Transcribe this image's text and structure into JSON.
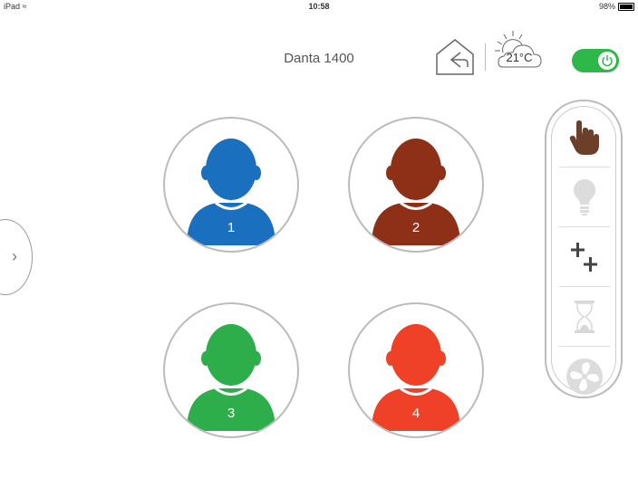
{
  "status_bar": {
    "device": "iPad",
    "time": "10:58",
    "battery": "98%"
  },
  "header": {
    "title": "Danta 1400",
    "temperature": "21°C"
  },
  "colors": {
    "accent": "#2eb84a",
    "user1": "#1a6fbf",
    "user2": "#8e2f18",
    "user3": "#2eae4a",
    "user4": "#ee4128"
  },
  "users": [
    {
      "label": "1",
      "color": "#1a6fbf"
    },
    {
      "label": "2",
      "color": "#8e2f18"
    },
    {
      "label": "3",
      "color": "#2eae4a"
    },
    {
      "label": "4",
      "color": "#ee4128"
    }
  ],
  "mode_panel": {
    "items": [
      "hand-icon",
      "bulb-icon",
      "plus-plus-icon",
      "hourglass-icon",
      "fan-icon"
    ]
  }
}
